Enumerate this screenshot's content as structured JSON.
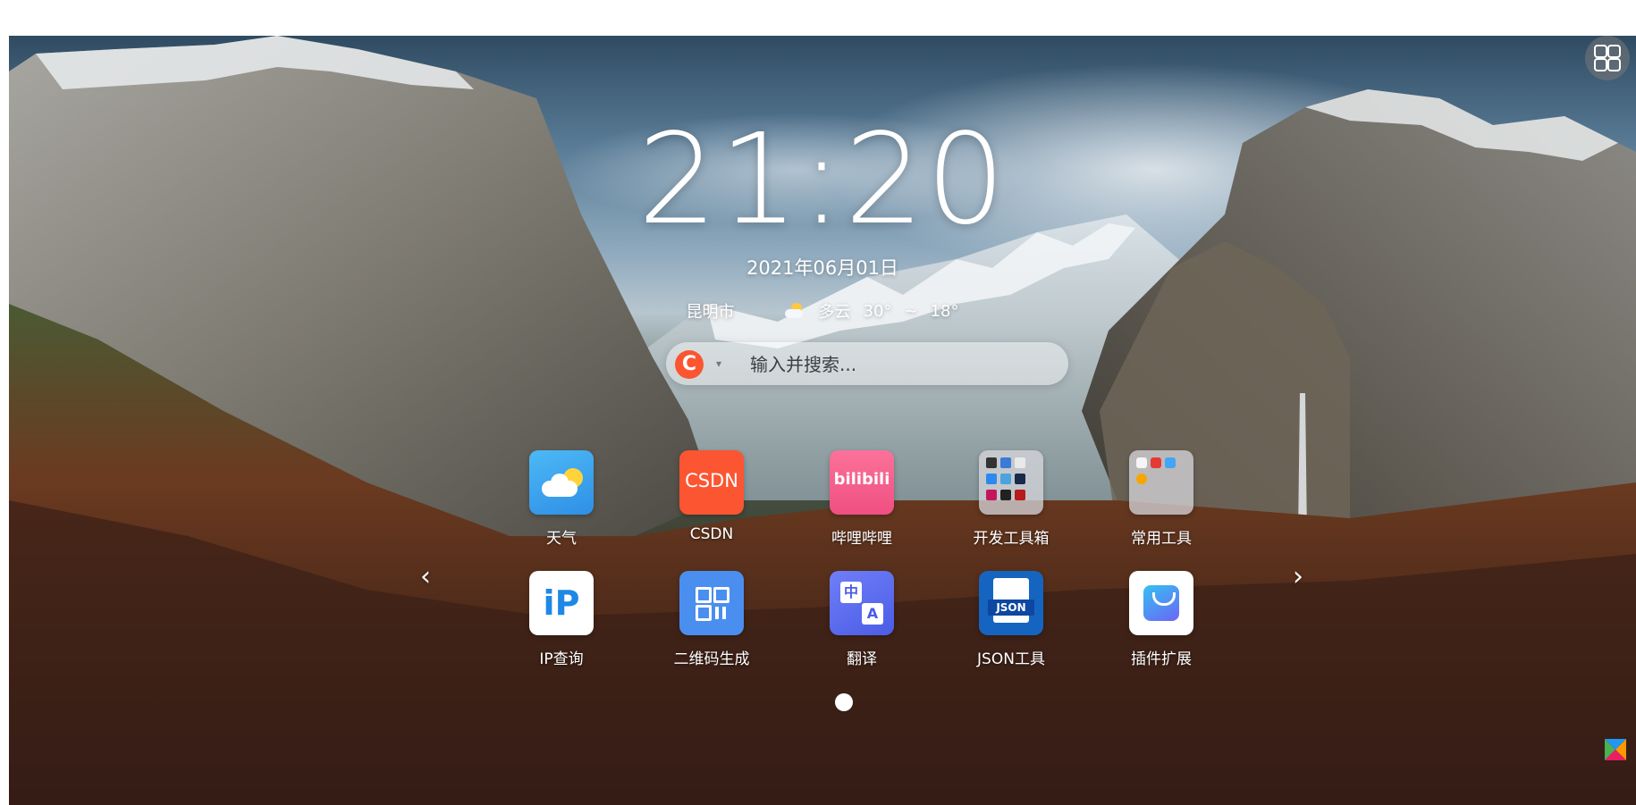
{
  "clock": {
    "time": "21:20"
  },
  "date": "2021年06月01日",
  "weather": {
    "city": "昆明市",
    "condition": "多云",
    "temp_high": "30°",
    "temp_low": "18°",
    "icon": "partly-cloudy-icon"
  },
  "search": {
    "placeholder": "输入并搜索...",
    "engine_label": "C",
    "engine_name": "CSDN"
  },
  "apps": [
    {
      "label": "天气",
      "icon": "weather-icon"
    },
    {
      "label": "CSDN",
      "icon": "csdn-icon",
      "tile_text": "CSDN"
    },
    {
      "label": "哔哩哔哩",
      "icon": "bilibili-icon",
      "tile_text": "bilibili"
    },
    {
      "label": "开发工具箱",
      "icon": "dev-toolbox-folder-icon"
    },
    {
      "label": "常用工具",
      "icon": "common-tools-folder-icon"
    },
    {
      "label": "IP查询",
      "icon": "ip-lookup-icon",
      "tile_text": "iP"
    },
    {
      "label": "二维码生成",
      "icon": "qrcode-icon"
    },
    {
      "label": "翻译",
      "icon": "translate-icon",
      "tile_text_a": "中",
      "tile_text_b": "A"
    },
    {
      "label": "JSON工具",
      "icon": "json-tool-icon",
      "tile_text": "JSON"
    },
    {
      "label": "插件扩展",
      "icon": "extension-shopping-bag-icon"
    }
  ],
  "pagination": {
    "current_page": 1,
    "total_pages": 1
  },
  "colors": {
    "csdn": "#fc5531",
    "bilibili": "#fb7299",
    "weather_tile": "#3aa6ee",
    "json_tile": "#1565c0",
    "translate_tile": "#5a6ef2",
    "qrcode_tile": "#4a8ef0"
  }
}
